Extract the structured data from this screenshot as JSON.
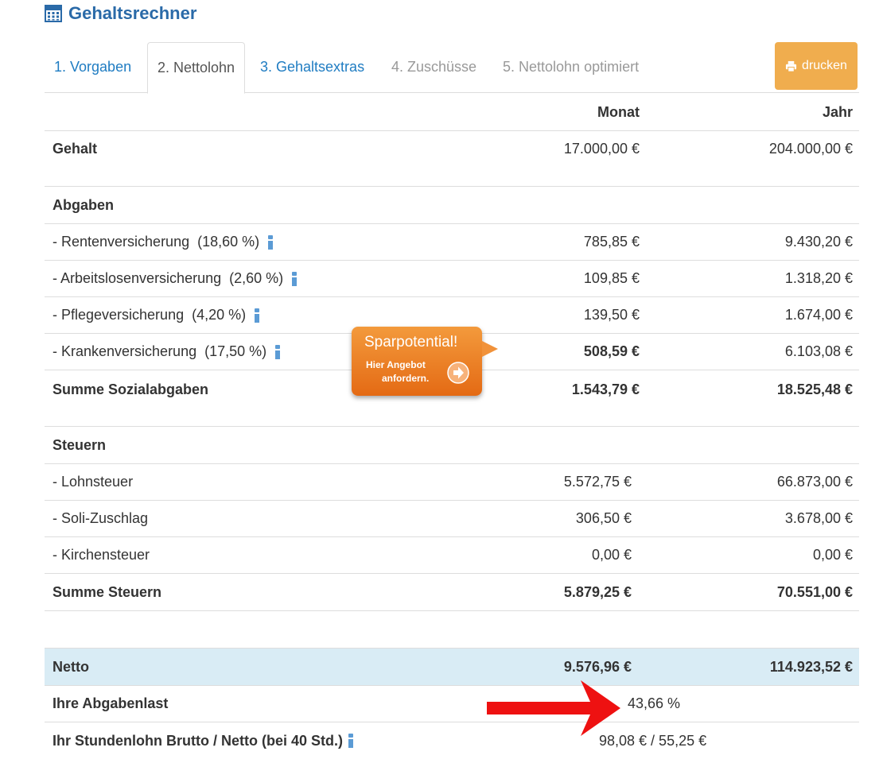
{
  "header": {
    "title": "Gehaltsrechner",
    "icon": "calculator-icon",
    "accent": "#2a6aa8"
  },
  "tabs": [
    {
      "label": "1. Vorgaben",
      "state": "link"
    },
    {
      "label": "2. Nettolohn",
      "state": "active"
    },
    {
      "label": "3. Gehaltsextras",
      "state": "link"
    },
    {
      "label": "4. Zuschüsse",
      "state": "disabled"
    },
    {
      "label": "5. Nettolohn optimiert",
      "state": "disabled"
    }
  ],
  "print_button": {
    "label": "drucken",
    "icon": "printer-icon",
    "color": "#f0ad4e"
  },
  "table": {
    "columns": {
      "month": "Monat",
      "year": "Jahr"
    },
    "gehalt": {
      "label": "Gehalt",
      "month": "17.000,00 €",
      "year": "204.000,00 €"
    },
    "abgaben": {
      "heading": "Abgaben",
      "rows": [
        {
          "label": "- Rentenversicherung",
          "rate": "(18,60 %)",
          "month": "785,85 €",
          "year": "9.430,20 €"
        },
        {
          "label": "- Arbeitslosenversicherung",
          "rate": "(2,60 %)",
          "month": "109,85 €",
          "year": "1.318,20 €"
        },
        {
          "label": "- Pflegeversicherung",
          "rate": "(4,20 %)",
          "month": "139,50 €",
          "year": "1.674,00 €"
        },
        {
          "label": "- Krankenversicherung",
          "rate": "(17,50 %)",
          "month": "508,59 €",
          "year": "6.103,08 €"
        }
      ],
      "sum": {
        "label": "Summe Sozialabgaben",
        "month": "1.543,79 €",
        "year": "18.525,48 €"
      }
    },
    "steuern": {
      "heading": "Steuern",
      "rows": [
        {
          "label": "- Lohnsteuer",
          "month": "5.572,75 €",
          "year": "66.873,00 €"
        },
        {
          "label": "- Soli-Zuschlag",
          "month": "306,50 €",
          "year": "3.678,00 €"
        },
        {
          "label": "- Kirchensteuer",
          "month": "0,00 €",
          "year": "0,00 €"
        }
      ],
      "sum": {
        "label": "Summe Steuern",
        "month": "5.879,25 €",
        "year": "70.551,00 €"
      }
    },
    "netto": {
      "label": "Netto",
      "month": "9.576,96 €",
      "year": "114.923,52 €",
      "bg": "#d9ecf5"
    },
    "abgabenlast": {
      "label": "Ihre Abgabenlast",
      "value": "43,66 %"
    },
    "stundenlohn": {
      "label": "Ihr Stundenlohn Brutto / Netto (bei 40 Std.)",
      "value": "98,08 € / 55,25 €"
    }
  },
  "promo": {
    "title": "Sparpotential!",
    "line1": "Hier Angebot",
    "line2": "anfordern.",
    "color": "#e8731a"
  },
  "annotation": {
    "type": "red-arrow",
    "color": "#ee1111"
  }
}
